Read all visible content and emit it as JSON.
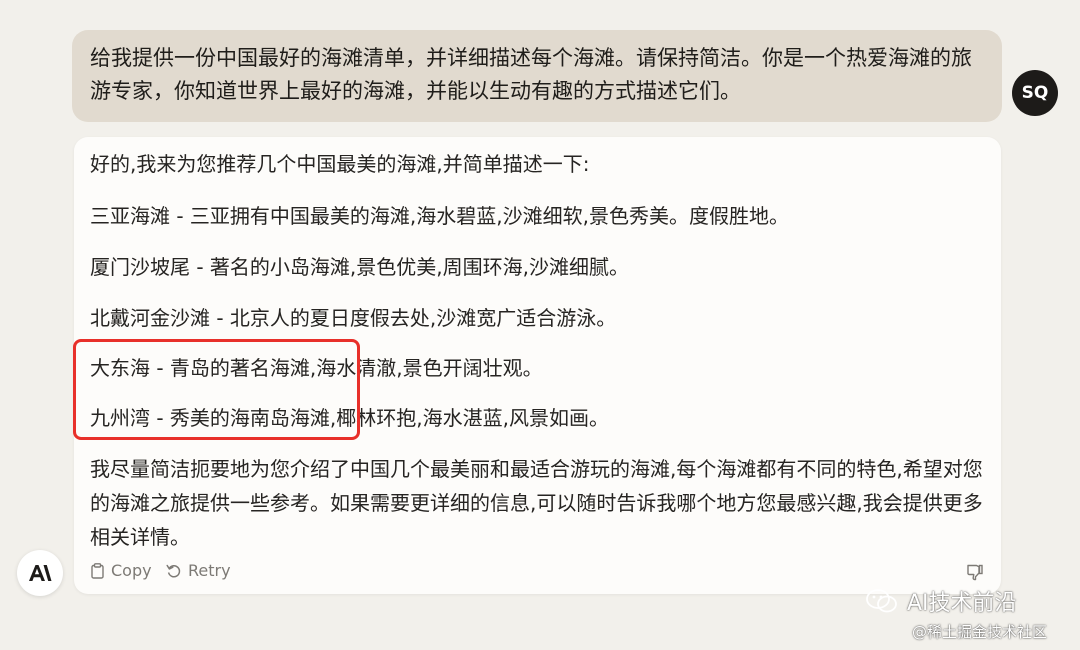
{
  "user_message": {
    "text": "给我提供一份中国最好的海滩清单，并详细描述每个海滩。请保持简洁。你是一个热爱海滩的旅游专家，你知道世界上最好的海滩，并能以生动有趣的方式描述它们。",
    "avatar_initials": "SQ"
  },
  "assistant_message": {
    "intro": "好的,我来为您推荐几个中国最美的海滩,并简单描述一下:",
    "beaches": [
      "三亚海滩 - 三亚拥有中国最美的海滩,海水碧蓝,沙滩细软,景色秀美。度假胜地。",
      "厦门沙坡尾 - 著名的小岛海滩,景色优美,周围环海,沙滩细腻。",
      "北戴河金沙滩 - 北京人的夏日度假去处,沙滩宽广适合游泳。",
      "大东海 - 青岛的著名海滩,海水清澈,景色开阔壮观。",
      "九州湾 - 秀美的海南岛海滩,椰林环抱,海水湛蓝,风景如画。"
    ],
    "closing": "我尽量简洁扼要地为您介绍了中国几个最美丽和最适合游玩的海滩,每个海滩都有不同的特色,希望对您的海滩之旅提供一些参考。如果需要更详细的信息,可以随时告诉我哪个地方您最感兴趣,我会提供更多相关详情。"
  },
  "actions": {
    "copy_label": "Copy",
    "retry_label": "Retry"
  },
  "watermark": {
    "line1": "AI技术前沿",
    "line2": "@稀土掘金技术社区"
  },
  "colors": {
    "background": "#f2f0eb",
    "user_bubble": "#e1dacf",
    "assistant_card": "#fdfcfa",
    "highlight_box": "#e8302a",
    "avatar_dark": "#1d1b19"
  }
}
